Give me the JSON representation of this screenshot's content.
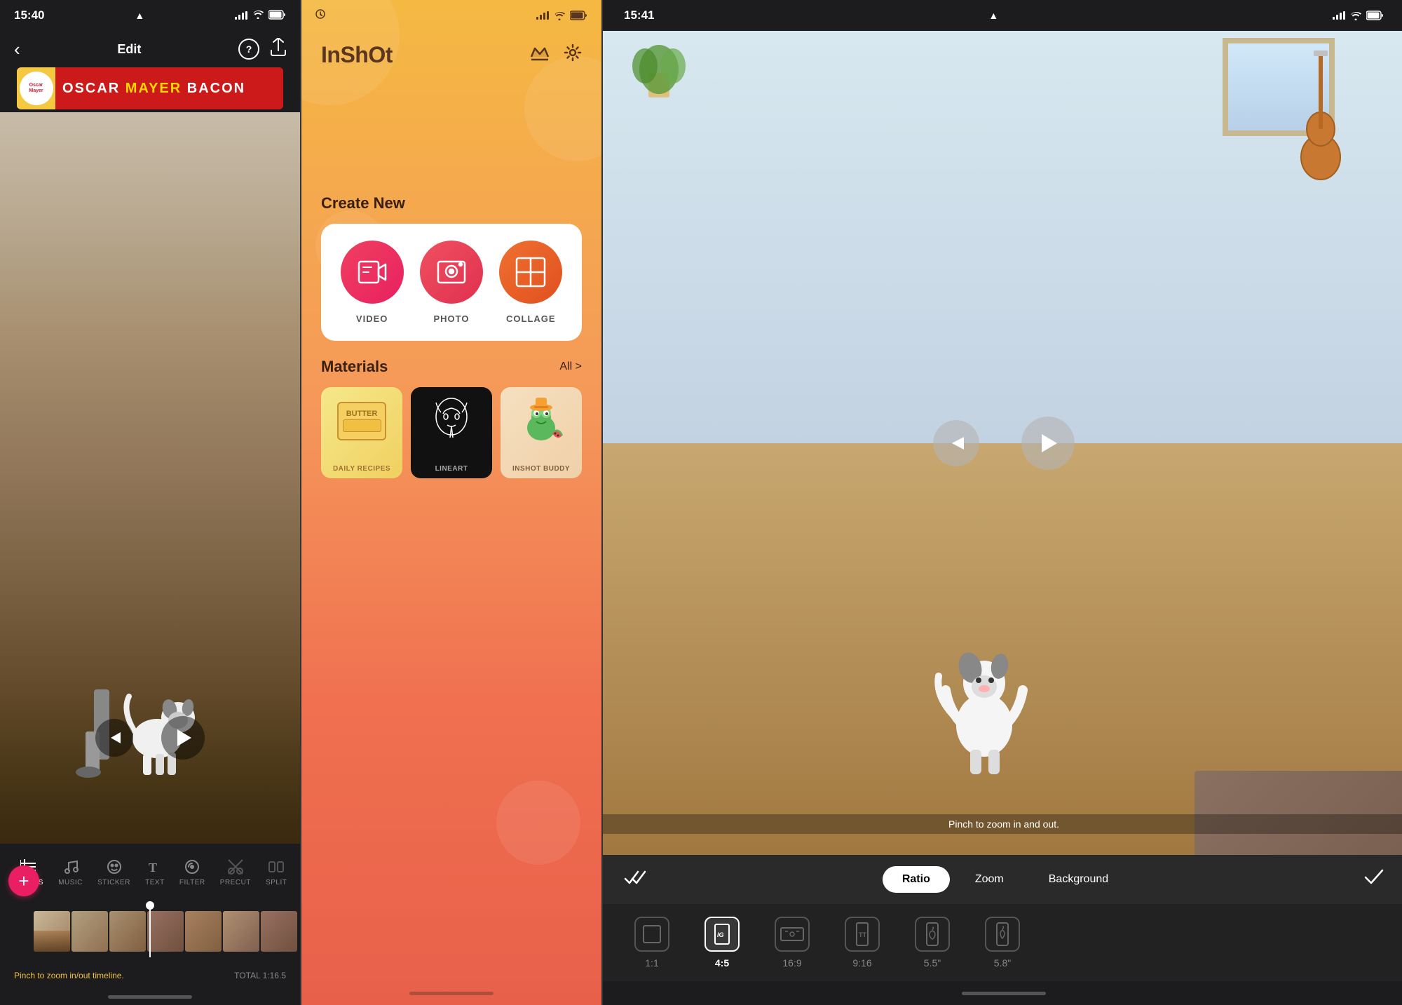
{
  "panel1": {
    "status_time": "15:40",
    "nav_title": "Edit",
    "ad_text": "OSCAR  MAYER  BACON",
    "ad_badge": "Oscar\nMayer",
    "video_hint": "Pinch to zoom in/out timeline.",
    "total_time": "TOTAL 1:16.5",
    "toolbar_items": [
      {
        "id": "canvas",
        "label": "CANVAS",
        "active": true
      },
      {
        "id": "music",
        "label": "MUSIC",
        "active": false
      },
      {
        "id": "sticker",
        "label": "STICKER",
        "active": false
      },
      {
        "id": "text",
        "label": "TEXT",
        "active": false
      },
      {
        "id": "filter",
        "label": "FILTER",
        "active": false
      },
      {
        "id": "precut",
        "label": "PRECUT",
        "active": false
      },
      {
        "id": "split",
        "label": "SPLIT",
        "active": false
      }
    ]
  },
  "panel2": {
    "status_time": "",
    "app_name": "InShOt",
    "create_new_label": "Create New",
    "items": [
      {
        "id": "video",
        "label": "VIDEO"
      },
      {
        "id": "photo",
        "label": "PHOTO"
      },
      {
        "id": "collage",
        "label": "COLLAGE"
      }
    ],
    "materials_label": "Materials",
    "all_label": "All >",
    "materials": [
      {
        "id": "recipes",
        "label": "DAILY RECIPES"
      },
      {
        "id": "lineart",
        "label": "LINEART"
      },
      {
        "id": "buddy",
        "label": "INSHOT BUDDY"
      }
    ]
  },
  "panel3": {
    "status_time": "15:41",
    "pinch_hint": "Pinch to zoom in and out.",
    "ratio_label": "Ratio",
    "zoom_label": "Zoom",
    "background_label": "Background",
    "ratio_options": [
      {
        "id": "1:1",
        "label": "1:1",
        "active": false
      },
      {
        "id": "4:5",
        "label": "4:5",
        "active": true
      },
      {
        "id": "16:9",
        "label": "16:9",
        "active": false
      },
      {
        "id": "9:16",
        "label": "9:16",
        "active": false
      },
      {
        "id": "5.5",
        "label": "5.5\"",
        "active": false
      },
      {
        "id": "5.8",
        "label": "5.8\"",
        "active": false
      }
    ]
  },
  "colors": {
    "accent_pink": "#e91e63",
    "toolbar_bg": "#1c1c1e",
    "inshot_orange": "#f5a040",
    "active_white": "#ffffff"
  }
}
